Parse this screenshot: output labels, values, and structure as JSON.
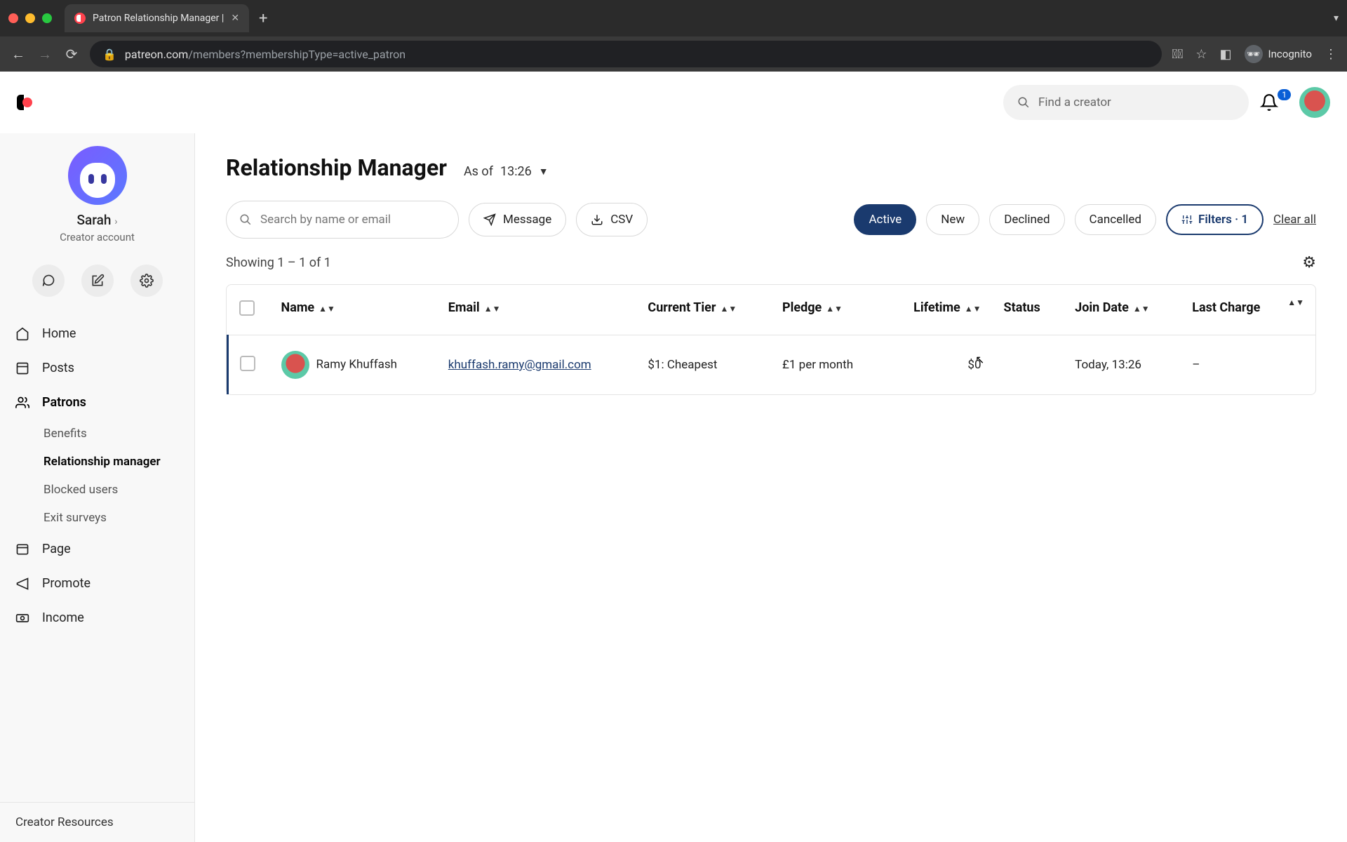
{
  "browser": {
    "tab_title": "Patron Relationship Manager |",
    "url_host": "patreon.com",
    "url_path": "/members?membershipType=active_patron",
    "incognito_label": "Incognito"
  },
  "topbar": {
    "search_placeholder": "Find a creator",
    "notification_count": "1"
  },
  "sidebar": {
    "profile_name": "Sarah",
    "profile_sub": "Creator account",
    "items": [
      {
        "label": "Home"
      },
      {
        "label": "Posts"
      },
      {
        "label": "Patrons"
      },
      {
        "label": "Page"
      },
      {
        "label": "Promote"
      },
      {
        "label": "Income"
      }
    ],
    "patrons_sub": [
      {
        "label": "Benefits"
      },
      {
        "label": "Relationship manager"
      },
      {
        "label": "Blocked users"
      },
      {
        "label": "Exit surveys"
      }
    ],
    "footer": "Creator Resources"
  },
  "page": {
    "title": "Relationship Manager",
    "asof_prefix": "As of",
    "asof_time": "13:26"
  },
  "toolbar": {
    "search_placeholder": "Search by name or email",
    "message_label": "Message",
    "csv_label": "CSV",
    "chips": {
      "active": "Active",
      "new": "New",
      "declined": "Declined",
      "cancelled": "Cancelled"
    },
    "filters_label": "Filters · 1",
    "clear_all": "Clear all"
  },
  "results": {
    "showing": "Showing 1 – 1 of 1"
  },
  "table": {
    "headers": {
      "name": "Name",
      "email": "Email",
      "tier": "Current Tier",
      "pledge": "Pledge",
      "lifetime": "Lifetime",
      "status": "Status",
      "join": "Join Date",
      "last": "Last Charge"
    },
    "rows": [
      {
        "name": "Ramy Khuffash",
        "email": "khuffash.ramy@gmail.com",
        "tier": "$1: Cheapest",
        "pledge": "£1 per month",
        "lifetime": "$0",
        "status": "",
        "join": "Today, 13:26",
        "last": "–"
      }
    ]
  }
}
